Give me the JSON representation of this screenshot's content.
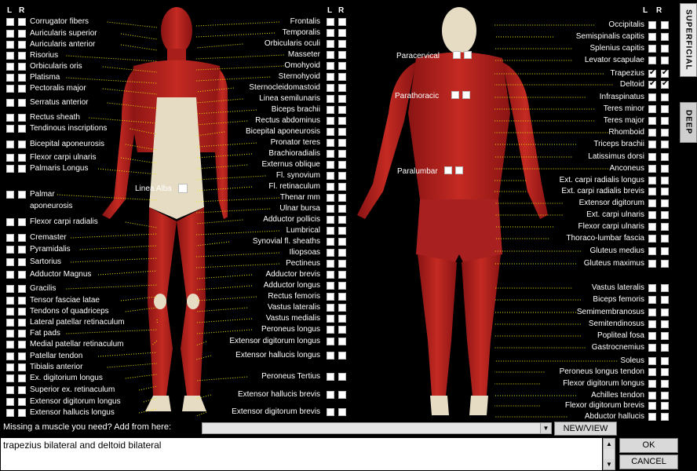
{
  "column_headers": {
    "left_L": "L",
    "left_R": "R",
    "right_L": "L",
    "right_R": "R"
  },
  "tabs": {
    "superficial": "SUPERFICIAL",
    "deep": "DEEP"
  },
  "front_left_muscles": [
    {
      "label": "Corrugator fibers"
    },
    {
      "label": "Auricularis superior"
    },
    {
      "label": "Auricularis anterior"
    },
    {
      "label": "Risorius"
    },
    {
      "label": "Orbicularis oris"
    },
    {
      "label": "Platisma"
    },
    {
      "label": "Pectoralis major"
    },
    {
      "label": "Serratus anterior"
    },
    {
      "label": "Rectus sheath"
    },
    {
      "label": "Tendinous inscriptions"
    },
    {
      "label": "Bicepital aponeurosis"
    },
    {
      "label": "Flexor carpi ulnaris"
    },
    {
      "label": "Palmaris Longus"
    },
    {
      "label": "Palmar"
    },
    {
      "label": "aponeurosis"
    },
    {
      "label": "Flexor carpi radialis"
    },
    {
      "label": "Cremaster"
    },
    {
      "label": "Pyramidalis"
    },
    {
      "label": "Sartorius"
    },
    {
      "label": "Adductor Magnus"
    },
    {
      "label": "Gracilis"
    },
    {
      "label": "Tensor fasciae latae"
    },
    {
      "label": "Tendons of quadriceps"
    },
    {
      "label": "Lateral patellar retinaculum"
    },
    {
      "label": "Fat pads"
    },
    {
      "label": "Medial patellar retinaculum"
    },
    {
      "label": "Patellar tendon"
    },
    {
      "label": "Tibialis anterior"
    },
    {
      "label": "Ex. digitorium longus"
    },
    {
      "label": "Superior ex. retinaculum"
    },
    {
      "label": "Extensor digitorum longus"
    },
    {
      "label": "Extensor hallucis longus"
    }
  ],
  "front_right_muscles": [
    {
      "label": "Frontalis"
    },
    {
      "label": "Temporalis"
    },
    {
      "label": "Orbicularis oculi"
    },
    {
      "label": "Masseter"
    },
    {
      "label": "Omohyoid"
    },
    {
      "label": "Sternohyoid"
    },
    {
      "label": "Sternocleidomastoid"
    },
    {
      "label": "Linea semilunaris"
    },
    {
      "label": "Biceps brachii"
    },
    {
      "label": "Rectus abdominus"
    },
    {
      "label": "Bicepital aponeurosis"
    },
    {
      "label": "Pronator teres"
    },
    {
      "label": "Brachioradialis"
    },
    {
      "label": "Externus oblique"
    },
    {
      "label": "Fl. synovium"
    },
    {
      "label": "Fl. retinaculum"
    },
    {
      "label": "Thenar mm"
    },
    {
      "label": "Ulnar bursa"
    },
    {
      "label": "Adductor pollicis"
    },
    {
      "label": "Lumbrical"
    },
    {
      "label": "Synovial fl. sheaths"
    },
    {
      "label": "Iliopsoas"
    },
    {
      "label": "Pectineus"
    },
    {
      "label": "Adductor brevis"
    },
    {
      "label": "Adductor longus"
    },
    {
      "label": "Rectus femoris"
    },
    {
      "label": "Vastus lateralis"
    },
    {
      "label": "Vastus medialis"
    },
    {
      "label": "Peroneus longus"
    },
    {
      "label": "Extensor digitorum longus"
    },
    {
      "label": "Extensor hallucis longus"
    },
    {
      "label": "Peroneus Tertius"
    },
    {
      "label": "Extensor hallucis brevis"
    },
    {
      "label": "Extensor digitorum brevis"
    }
  ],
  "linea_alba": "Linea Alba",
  "back_left_labels": [
    {
      "label": "Paracervical"
    },
    {
      "label": "Parathoracic"
    },
    {
      "label": "Paralumbar"
    }
  ],
  "back_right_muscles": [
    {
      "label": "Occipitalis",
      "L": false,
      "R": false
    },
    {
      "label": "Semispinalis capitis",
      "L": false,
      "R": false
    },
    {
      "label": "Splenius capitis",
      "L": false,
      "R": false
    },
    {
      "label": "Levator scapulae",
      "L": false,
      "R": false
    },
    {
      "label": "Trapezius",
      "L": true,
      "R": true
    },
    {
      "label": "Deltoid",
      "L": true,
      "R": true
    },
    {
      "label": "Infraspinatus",
      "L": false,
      "R": false
    },
    {
      "label": "Teres minor",
      "L": false,
      "R": false
    },
    {
      "label": "Teres major",
      "L": false,
      "R": false
    },
    {
      "label": "Rhomboid",
      "L": false,
      "R": false
    },
    {
      "label": "Triceps brachii",
      "L": false,
      "R": false
    },
    {
      "label": "Latissimus dorsi",
      "L": false,
      "R": false
    },
    {
      "label": "Anconeus",
      "L": false,
      "R": false
    },
    {
      "label": "Ext. carpi radialis longus",
      "L": false,
      "R": false
    },
    {
      "label": "Ext. carpi radialis brevis",
      "L": false,
      "R": false
    },
    {
      "label": "Extensor digitorum",
      "L": false,
      "R": false
    },
    {
      "label": "Ext. carpi ulnaris",
      "L": false,
      "R": false
    },
    {
      "label": "Flexor carpi ulnaris",
      "L": false,
      "R": false
    },
    {
      "label": "Thoraco-lumbar fascia",
      "L": false,
      "R": false
    },
    {
      "label": "Gluteus medius",
      "L": false,
      "R": false
    },
    {
      "label": "Gluteus maximus",
      "L": false,
      "R": false
    },
    {
      "label": "Vastus lateralis",
      "L": false,
      "R": false
    },
    {
      "label": "Biceps femoris",
      "L": false,
      "R": false
    },
    {
      "label": "Semimembranosus",
      "L": false,
      "R": false
    },
    {
      "label": "Semitendinosus",
      "L": false,
      "R": false
    },
    {
      "label": "Popliteal fosa",
      "L": false,
      "R": false
    },
    {
      "label": "Gastrocnemius",
      "L": false,
      "R": false
    },
    {
      "label": "Soleus",
      "L": false,
      "R": false
    },
    {
      "label": "Peroneus longus tendon",
      "L": false,
      "R": false
    },
    {
      "label": "Flexor digitorum longus",
      "L": false,
      "R": false
    },
    {
      "label": "Achilles tendon",
      "L": false,
      "R": false
    },
    {
      "label": "Flexor digitorum brevis",
      "L": false,
      "R": false
    },
    {
      "label": "Abductor hallucis",
      "L": false,
      "R": false
    }
  ],
  "bottom": {
    "prompt": "Missing a muscle you need? Add from here:",
    "combo_value": "",
    "new_view_label": "NEW/VIEW",
    "notes_text": "trapezius bilateral and deltoid bilateral",
    "ok_label": "OK",
    "cancel_label": "CANCEL"
  },
  "colors": {
    "leader": "#e8e800",
    "muscle": "#b82020",
    "muscle_dark": "#7a1010",
    "fascia": "#e8dcc0"
  }
}
